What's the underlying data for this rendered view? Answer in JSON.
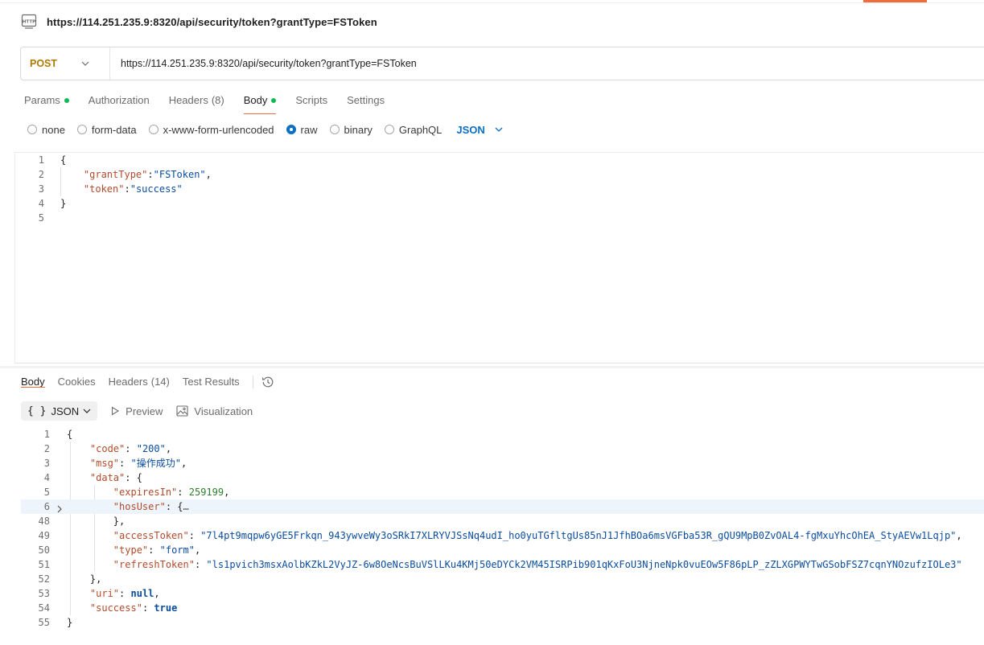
{
  "request": {
    "title": "https://114.251.235.9:8320/api/security/token?grantType=FSToken",
    "method": "POST",
    "url": "https://114.251.235.9:8320/api/security/token?grantType=FSToken"
  },
  "request_tabs": [
    {
      "label": "Params",
      "dot": true
    },
    {
      "label": "Authorization"
    },
    {
      "label": "Headers",
      "count": "(8)"
    },
    {
      "label": "Body",
      "dot": true,
      "active": true
    },
    {
      "label": "Scripts"
    },
    {
      "label": "Settings"
    }
  ],
  "body_modes": {
    "options": [
      "none",
      "form-data",
      "x-www-form-urlencoded",
      "raw",
      "binary",
      "GraphQL"
    ],
    "selected": "raw",
    "language": "JSON"
  },
  "request_body_lines": [
    {
      "n": "1",
      "code": "{"
    },
    {
      "n": "2",
      "code": "    \"grantType\":\"FSToken\","
    },
    {
      "n": "3",
      "code": "    \"token\":\"success\""
    },
    {
      "n": "4",
      "code": "}"
    },
    {
      "n": "5",
      "code": ""
    }
  ],
  "response_tabs": [
    {
      "label": "Body",
      "active": true
    },
    {
      "label": "Cookies"
    },
    {
      "label": "Headers",
      "count": "(14)"
    },
    {
      "label": "Test Results"
    }
  ],
  "response_toolbar": {
    "format": "JSON",
    "preview": "Preview",
    "visualization": "Visualization"
  },
  "response_lines": [
    {
      "n": "1",
      "code": "{"
    },
    {
      "n": "2",
      "code": "    \"code\": \"200\","
    },
    {
      "n": "3",
      "code": "    \"msg\": \"操作成功\","
    },
    {
      "n": "4",
      "code": "    \"data\": {"
    },
    {
      "n": "5",
      "code": "        \"expiresIn\": 259199,"
    },
    {
      "n": "6",
      "code": "        \"hosUser\": {…",
      "folded": true,
      "highlight": true
    },
    {
      "n": "48",
      "code": "        },"
    },
    {
      "n": "49",
      "code": "        \"accessToken\": \"7l4pt9mqpw6yGE5Frkqn_943ywveWy3oSRkI7XLRYVJSsNq4udI_ho0yuTGfltgUs85nJ1JfhBOa6msVGFba53R_gQU9MpB0ZvOAL4-fgMxuYhcOhEA_StyAEVw1Lqjp\","
    },
    {
      "n": "50",
      "code": "        \"type\": \"form\","
    },
    {
      "n": "51",
      "code": "        \"refreshToken\": \"ls1pvich3msxAolbKZkL2VyJZ-6w8OeNcsBuVSlLKu4KMj50eDYCk2VM45ISRPib901qKxFoU3NjneNpk0vuEOw5F86pLP_zZLXGPWYTwGSobFSZ7cqnYNOzufzIOLe3\""
    },
    {
      "n": "52",
      "code": "    },"
    },
    {
      "n": "53",
      "code": "    \"uri\": null,"
    },
    {
      "n": "54",
      "code": "    \"success\": true"
    },
    {
      "n": "55",
      "code": "}"
    }
  ],
  "colors": {
    "accent": "#f26b3a",
    "method_post": "#ad7a03",
    "link_blue": "#0c6fc4",
    "dot_green": "#0cbb52",
    "json_key": "#b14b2c",
    "json_string": "#0a4c9e",
    "json_number": "#2d7d2f"
  },
  "icons": [
    "http-icon",
    "chevron-down-icon",
    "history-icon",
    "play-icon",
    "image-icon",
    "chevron-right-icon"
  ]
}
